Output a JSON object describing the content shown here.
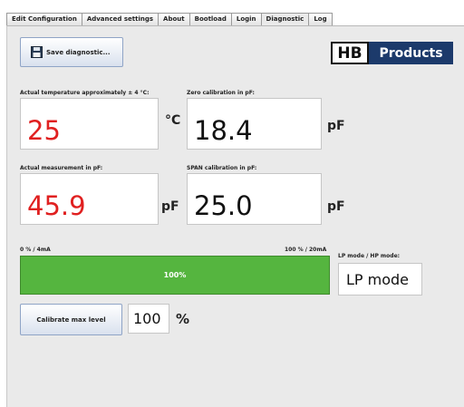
{
  "tabs": [
    {
      "label": "Edit Configuration",
      "active": false
    },
    {
      "label": "Advanced settings",
      "active": false
    },
    {
      "label": "About",
      "active": false
    },
    {
      "label": "Bootload",
      "active": false
    },
    {
      "label": "Login",
      "active": false
    },
    {
      "label": "Diagnostic",
      "active": true
    },
    {
      "label": "Log",
      "active": false
    }
  ],
  "toolbar": {
    "save_label": "Save diagnostic...",
    "save_icon": "floppy-disk-icon"
  },
  "logo": {
    "left_text": "HB",
    "right_text": "Products",
    "brand_color": "#1c3a6b"
  },
  "temperature": {
    "label": "Actual temperature approximately ± 4 °C:",
    "value": "25",
    "unit": "°C"
  },
  "zero_cal": {
    "label": "Zero calibration in pF:",
    "value": "18.4",
    "unit": "pF"
  },
  "measurement": {
    "label": "Actual measurement in pF:",
    "value": "45.9",
    "unit": "pF"
  },
  "span_cal": {
    "label": "SPAN calibration in pF:",
    "value": "25.0",
    "unit": "pF"
  },
  "progress": {
    "min_label": "0 % / 4mA",
    "max_label": "100 % / 20mA",
    "value_label": "100%",
    "value": 100,
    "bar_color": "#55b53f"
  },
  "mode": {
    "label": "LP mode / HP mode:",
    "value": "LP mode"
  },
  "calibrate": {
    "button_label": "Calibrate max level",
    "level_value": "100",
    "unit": "%"
  },
  "colors": {
    "value_red": "#e02020"
  }
}
